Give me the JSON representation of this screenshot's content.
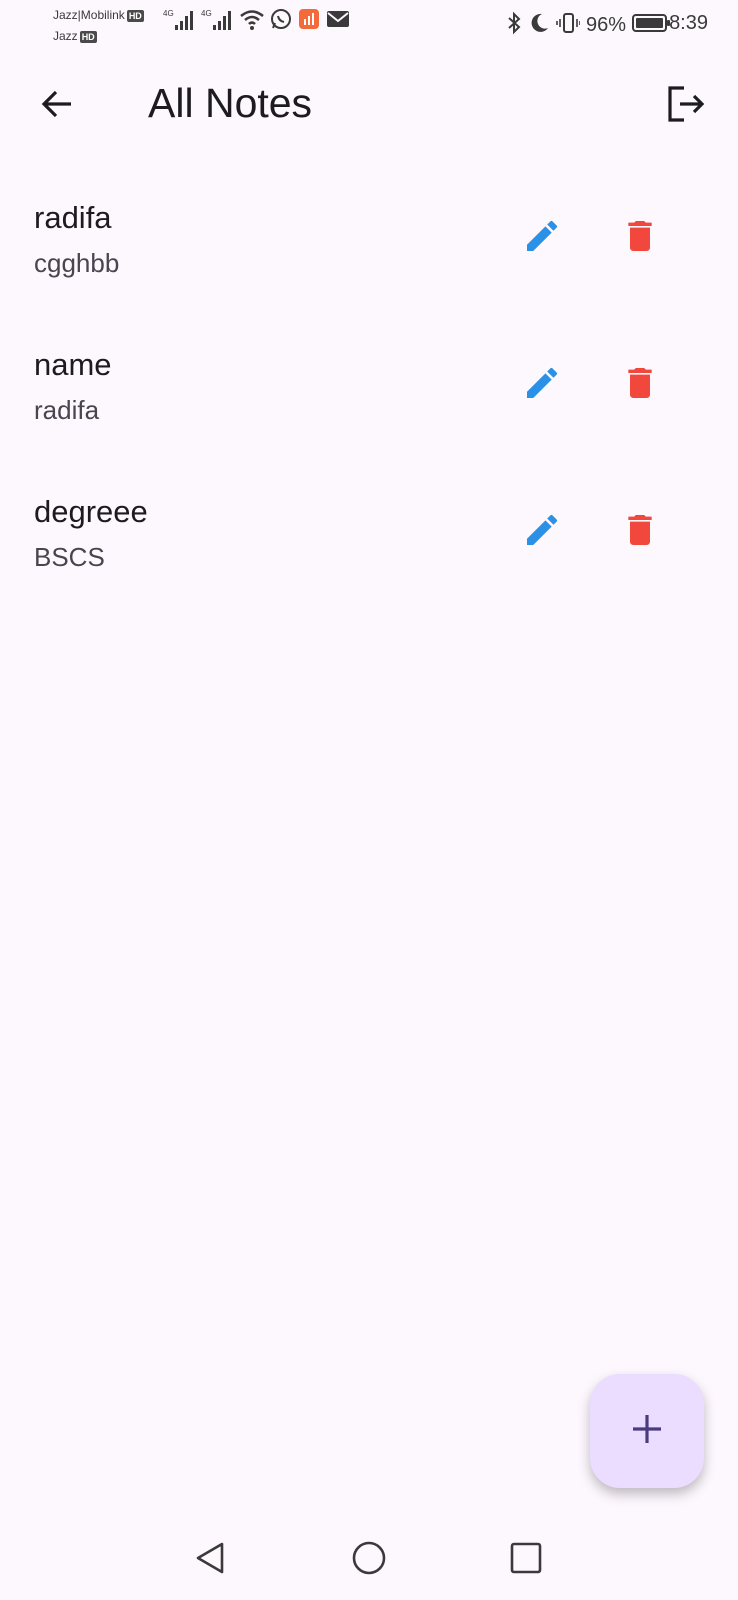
{
  "status_bar": {
    "carrier_line1": "Jazz|Mobilink",
    "carrier_line2": "Jazz",
    "hd_badge": "HD",
    "network_label": "4G",
    "battery": "96%",
    "time": "8:39"
  },
  "app_bar": {
    "title": "All Notes"
  },
  "notes": [
    {
      "title": "radifa",
      "description": "cgghbb"
    },
    {
      "title": "name",
      "description": "radifa"
    },
    {
      "title": "degreee",
      "description": "BSCS"
    }
  ],
  "colors": {
    "background": "#fdf7fe",
    "edit": "#2b91e6",
    "delete": "#f1473d",
    "fab": "#eaddff",
    "fab_icon": "#4a3b7c"
  },
  "icons": {
    "back": "arrow-left-icon",
    "logout": "logout-icon",
    "edit": "pencil-icon",
    "delete": "trash-icon",
    "fab": "plus-icon"
  }
}
